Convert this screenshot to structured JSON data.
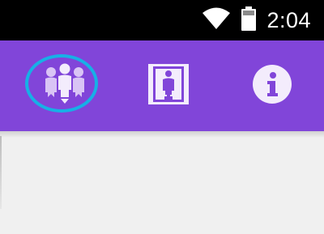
{
  "status_bar": {
    "time": "2:04",
    "icons": [
      "wifi-icon",
      "battery-icon"
    ]
  },
  "toolbar": {
    "background": "#8145d9",
    "tabs": [
      {
        "name": "people-tab",
        "icon": "people-group-icon",
        "selected": true
      },
      {
        "name": "medical-tab",
        "icon": "medical-person-icon",
        "selected": false
      },
      {
        "name": "info-tab",
        "icon": "info-icon",
        "selected": false
      }
    ],
    "selection_color": "#17b0e6"
  }
}
